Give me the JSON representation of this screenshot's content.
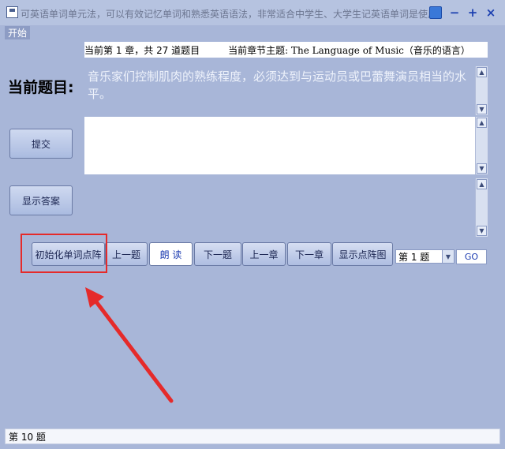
{
  "window": {
    "title": "可英语单词单元法，可以有效记忆单词和熟悉英语语法，非常适合中学生、大学生记英语单词是使用",
    "minimize": "−",
    "maximize": "+",
    "close": "×"
  },
  "menu": {
    "start": "开始"
  },
  "info": {
    "progress": "当前第 1 章，共 27 道题目",
    "theme": "当前章节主题: The Language of Music（音乐的语言）"
  },
  "labels": {
    "current_question": "当前题目:"
  },
  "question_text": "音乐家们控制肌肉的熟练程度，必须达到与运动员或巴蕾舞演员相当的水平。",
  "side_buttons": {
    "submit": "提交",
    "show_answer": "显示答案"
  },
  "bottom_buttons": {
    "init_matrix": "初始化单词点阵",
    "prev_question": "上一题",
    "read": "朗 读",
    "next_question": "下一题",
    "prev_chapter": "上一章",
    "next_chapter": "下一章",
    "show_matrix": "显示点阵图"
  },
  "question_select": {
    "value": "第 1 题"
  },
  "go_label": "GO",
  "status": "第 10 题",
  "colors": {
    "highlight": "#e52a2a",
    "background": "#a8b6d8"
  }
}
